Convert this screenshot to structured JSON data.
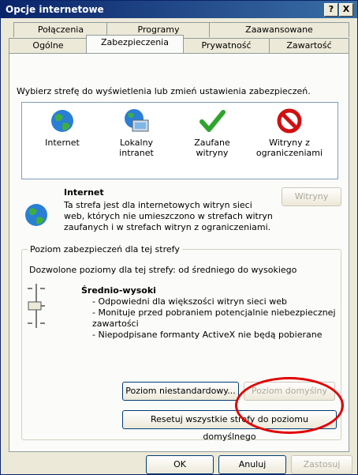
{
  "window": {
    "title": "Opcje internetowe",
    "help": "?",
    "close": "X"
  },
  "tabs_back": [
    "Połączenia",
    "Programy",
    "Zaawansowane"
  ],
  "tabs_front": [
    "Ogólne",
    "Zabezpieczenia",
    "Prywatność",
    "Zawartość"
  ],
  "instruction": "Wybierz strefę do wyświetlenia lub zmień ustawienia zabezpieczeń.",
  "zones": [
    {
      "line1": "Internet",
      "line2": "",
      "icon": "globe-icon"
    },
    {
      "line1": "Lokalny",
      "line2": "intranet",
      "icon": "intranet-icon"
    },
    {
      "line1": "Zaufane",
      "line2": "witryny",
      "icon": "checkmark-icon"
    },
    {
      "line1": "Witryny z",
      "line2": "ograniczeniami",
      "icon": "prohibited-icon"
    }
  ],
  "zone_info": {
    "title": "Internet",
    "lines": [
      "Ta strefa jest dla internetowych witryn sieci",
      "web, których nie umieszczono w strefach witryn",
      "zaufanych i w strefach witryn z ograniczeniami."
    ],
    "sites_button": "Witryny"
  },
  "security_level": {
    "group_label": "Poziom zabezpieczeń dla tej strefy",
    "allowed": "Dozwolone poziomy dla tej strefy: od średniego do wysokiego",
    "level_name": "Średnio-wysoki",
    "bullets": [
      "- Odpowiedni dla większości witryn sieci web",
      "- Monituje przed pobraniem potencjalnie niebezpiecznej",
      "zawartości",
      "- Niepodpisane formanty ActiveX nie będą pobierane"
    ],
    "custom_button": "Poziom niestandardowy...",
    "default_button": "Poziom domyślny",
    "reset_button": "Resetuj wszystkie strefy do poziomu domyślnego"
  },
  "footer": {
    "ok": "OK",
    "cancel": "Anuluj",
    "apply": "Zastosuj"
  },
  "colors": {
    "highlight_circle": "#e00000",
    "title_bar": "#0a246a"
  }
}
